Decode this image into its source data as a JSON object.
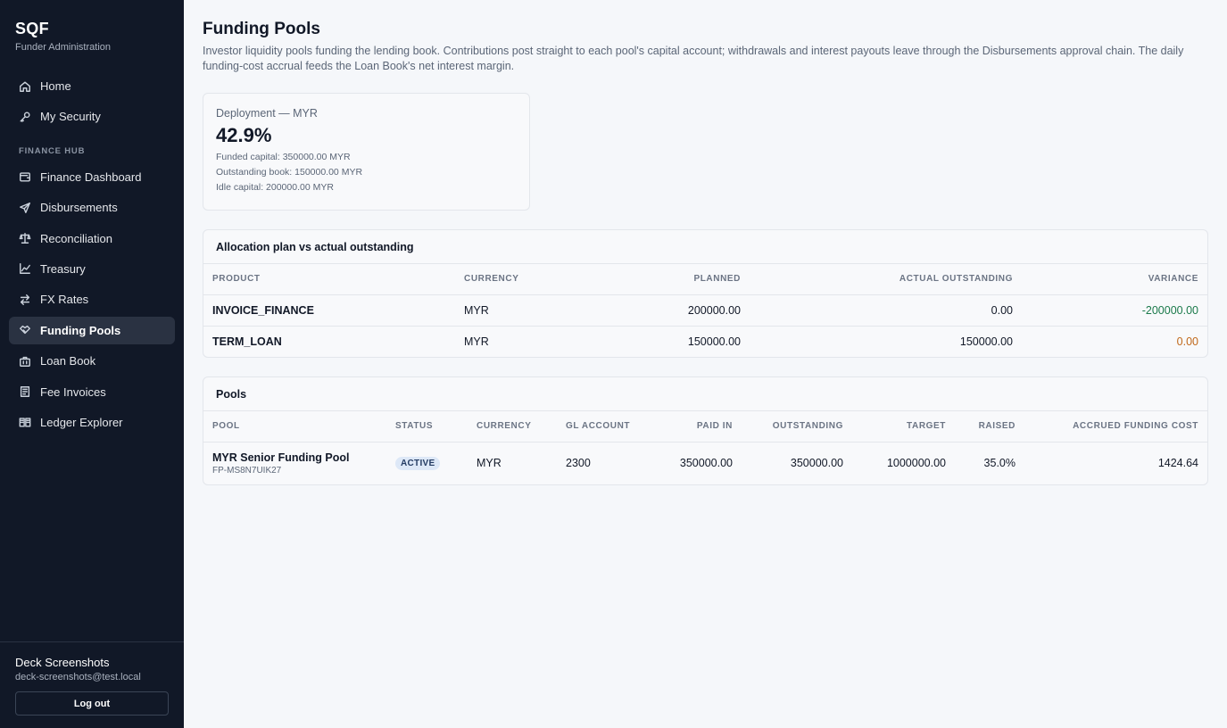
{
  "brand": {
    "title": "SQF",
    "subtitle": "Funder Administration"
  },
  "nav": {
    "top_items": [
      {
        "label": "Home",
        "icon": "home-icon"
      },
      {
        "label": "My Security",
        "icon": "key-icon"
      }
    ],
    "section_label": "FINANCE HUB",
    "items": [
      {
        "label": "Finance Dashboard",
        "icon": "wallet-icon"
      },
      {
        "label": "Disbursements",
        "icon": "send-icon"
      },
      {
        "label": "Reconciliation",
        "icon": "scale-icon"
      },
      {
        "label": "Treasury",
        "icon": "chart-line-icon"
      },
      {
        "label": "FX Rates",
        "icon": "swap-icon"
      },
      {
        "label": "Funding Pools",
        "icon": "handshake-icon",
        "active": true
      },
      {
        "label": "Loan Book",
        "icon": "briefcase-icon"
      },
      {
        "label": "Fee Invoices",
        "icon": "receipt-icon"
      },
      {
        "label": "Ledger Explorer",
        "icon": "book-icon"
      }
    ]
  },
  "user": {
    "name": "Deck Screenshots",
    "email": "deck-screenshots@test.local",
    "logout_label": "Log out"
  },
  "page": {
    "title": "Funding Pools",
    "description": "Investor liquidity pools funding the lending book. Contributions post straight to each pool's capital account; withdrawals and interest payouts leave through the Disbursements approval chain. The daily funding-cost accrual feeds the Loan Book's net interest margin."
  },
  "deployment": {
    "label": "Deployment — MYR",
    "value": "42.9%",
    "funded": "Funded capital: 350000.00 MYR",
    "outstanding": "Outstanding book: 150000.00 MYR",
    "idle": "Idle capital: 200000.00 MYR"
  },
  "allocation": {
    "title": "Allocation plan vs actual outstanding",
    "headers": {
      "product": "PRODUCT",
      "currency": "CURRENCY",
      "planned": "PLANNED",
      "actual": "ACTUAL OUTSTANDING",
      "variance": "VARIANCE"
    },
    "rows": [
      {
        "product": "INVOICE_FINANCE",
        "currency": "MYR",
        "planned": "200000.00",
        "actual": "0.00",
        "variance": "-200000.00"
      },
      {
        "product": "TERM_LOAN",
        "currency": "MYR",
        "planned": "150000.00",
        "actual": "150000.00",
        "variance": "0.00"
      }
    ]
  },
  "pools": {
    "title": "Pools",
    "headers": {
      "pool": "POOL",
      "status": "STATUS",
      "currency": "CURRENCY",
      "gl": "GL ACCOUNT",
      "paid_in": "PAID IN",
      "outstanding": "OUTSTANDING",
      "target": "TARGET",
      "raised": "RAISED",
      "accrued": "ACCRUED FUNDING COST"
    },
    "rows": [
      {
        "name": "MYR Senior Funding Pool",
        "id": "FP-MS8N7UIK27",
        "status": "ACTIVE",
        "currency": "MYR",
        "gl": "2300",
        "paid_in": "350000.00",
        "outstanding": "350000.00",
        "target": "1000000.00",
        "raised": "35.0%",
        "accrued": "1424.64"
      }
    ]
  },
  "colors": {
    "sidebar_bg": "#111827",
    "active_bg": "#2a3242",
    "negative": "#1b7a4b",
    "zero_variance": "#c0681a",
    "badge_bg": "#dde8f7"
  }
}
